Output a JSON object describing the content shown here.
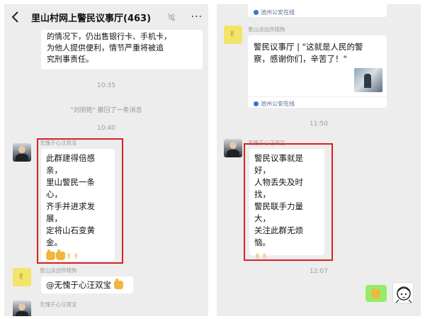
{
  "left": {
    "header": {
      "title": "里山村网上警民议事厅(463)",
      "more": "···"
    },
    "top_bubble_lines": [
      "的情况下，仍出售银行卡、手机卡，",
      "为他人提供便利，情节严重将被追",
      "究刑事责任。"
    ],
    "time1": "10:35",
    "recall": "\"刘丽艳\" 撤回了一条消息",
    "time2": "10:40",
    "msg1": {
      "sender": "无愧于心汪双宝",
      "lines": [
        "此群建得倍感",
        "亲，",
        "里山警民一条",
        "心，",
        "齐手并进求发",
        "展，",
        "定将山石变黄",
        "金。"
      ]
    },
    "msg2": {
      "sender": "里山派出所辖狗",
      "text": "@无愧于心汪双宝"
    },
    "msg3": {
      "sender": "无愧于心汪双宝"
    }
  },
  "right": {
    "source_top": "池州公安在线",
    "msg1": {
      "sender": "里山派出所辖狗",
      "lines": [
        "警民议事厅 | \"这就是人民的警",
        "察，感谢你们，辛苦了！\""
      ],
      "source": "池州公安在线"
    },
    "time1": "11:50",
    "msg2": {
      "sender": "无愧于心汪双宝",
      "lines": [
        "警民议事就是",
        "好，",
        "人物丢失及时",
        "找，",
        "警民联手力量",
        "大，",
        "关注此群无烦",
        "恼。"
      ]
    },
    "time2": "12:07"
  },
  "colors": {
    "highlight": "#d92121",
    "chat_bg": "#ededed",
    "self_bubble": "#95ec69",
    "link": "#576b95"
  },
  "icons": [
    "back-arrow-icon",
    "mute-icon",
    "more-icon",
    "thumbs-up-icon",
    "victory-hand-icon",
    "link-source-icon"
  ]
}
